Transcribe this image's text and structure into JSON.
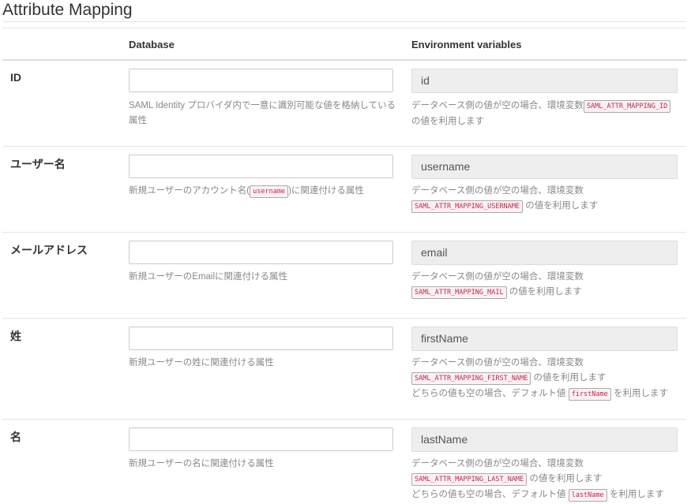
{
  "page": {
    "title": "Attribute Mapping"
  },
  "columns": {
    "database": "Database",
    "environment": "Environment variables"
  },
  "rows": [
    {
      "label": "ID",
      "db_value": "",
      "env_value": "id",
      "db_help": "SAML Identity プロバイダ内で一意に識別可能な値を格納している属性",
      "env_help_prefix": "データベース側の値が空の場合、環境変数",
      "env_var": "SAML_ATTR_MAPPING_ID",
      "env_help_suffix": "の値を利用します"
    },
    {
      "label": "ユーザー名",
      "db_value": "",
      "env_value": "username",
      "db_help_prefix": "新規ユーザーのアカウント名(",
      "db_help_code": "username",
      "db_help_suffix": ")に関連付ける属性",
      "env_help_prefix": "データベース側の値が空の場合、環境変数",
      "env_var": "SAML_ATTR_MAPPING_USERNAME",
      "env_help_suffix": "の値を利用します"
    },
    {
      "label": "メールアドレス",
      "db_value": "",
      "env_value": "email",
      "db_help": "新規ユーザーのEmailに関連付ける属性",
      "env_help_prefix": "データベース側の値が空の場合、環境変数",
      "env_var": "SAML_ATTR_MAPPING_MAIL",
      "env_help_suffix": "の値を利用します"
    },
    {
      "label": "姓",
      "db_value": "",
      "env_value": "firstName",
      "db_help": "新規ユーザーの姓に関連付ける属性",
      "env_help_prefix": "データベース側の値が空の場合、環境変数",
      "env_var": "SAML_ATTR_MAPPING_FIRST_NAME",
      "env_help_suffix": "の値を利用します",
      "default_prefix": "どちらの値も空の場合、デフォルト値",
      "default_code": "firstName",
      "default_suffix": "を利用します"
    },
    {
      "label": "名",
      "db_value": "",
      "env_value": "lastName",
      "db_help": "新規ユーザーの名に関連付ける属性",
      "env_help_prefix": "データベース側の値が空の場合、環境変数",
      "env_var": "SAML_ATTR_MAPPING_LAST_NAME",
      "env_help_suffix": "の値を利用します",
      "default_prefix": "どちらの値も空の場合、デフォルト値",
      "default_code": "lastName",
      "default_suffix": "を利用します"
    }
  ]
}
